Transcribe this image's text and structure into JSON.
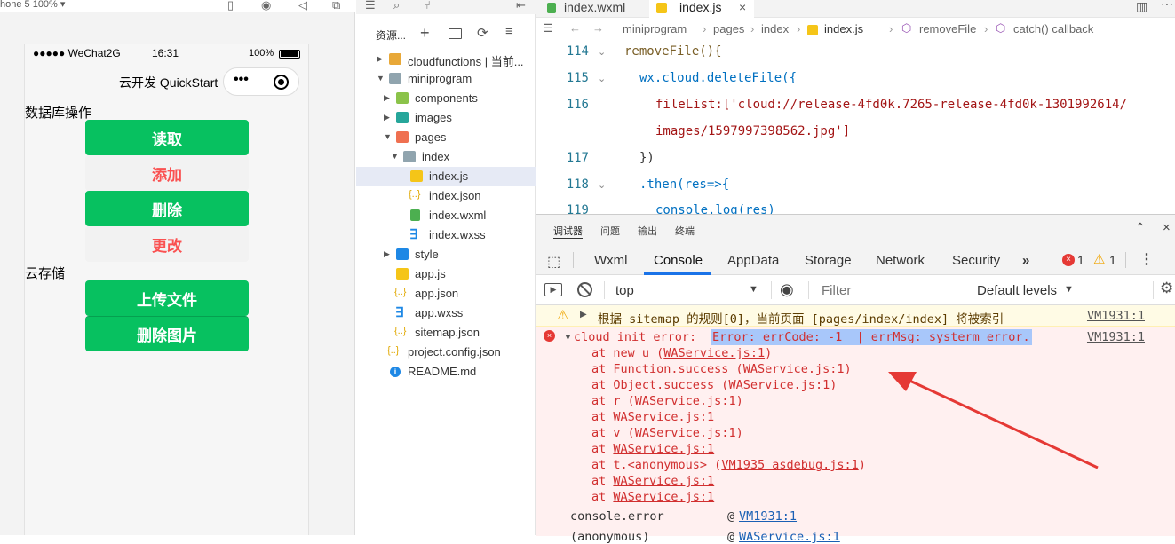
{
  "simulator": {
    "device_label": "hone 5 100% ▾",
    "status_carrier": "●●●●● WeChat2G",
    "status_time": "16:31",
    "status_battery": "100%",
    "nav_title": "云开发 QuickStart",
    "capsule_dots": "•••",
    "section_db": "数据库操作",
    "btn_read": "读取",
    "btn_add": "添加",
    "btn_delete": "删除",
    "btn_update": "更改",
    "section_storage": "云存储",
    "btn_upload": "上传文件",
    "btn_delete_image": "删除图片"
  },
  "explorer": {
    "title": "资源...",
    "items": [
      {
        "label": "cloudfunctions | 当前..."
      },
      {
        "label": "miniprogram"
      },
      {
        "label": "components"
      },
      {
        "label": "images"
      },
      {
        "label": "pages"
      },
      {
        "label": "index"
      },
      {
        "label": "index.js"
      },
      {
        "label": "index.json"
      },
      {
        "label": "index.wxml"
      },
      {
        "label": "index.wxss"
      },
      {
        "label": "style"
      },
      {
        "label": "app.js"
      },
      {
        "label": "app.json"
      },
      {
        "label": "app.wxss"
      },
      {
        "label": "sitemap.json"
      },
      {
        "label": "project.config.json"
      },
      {
        "label": "README.md"
      }
    ]
  },
  "editor": {
    "tabs": [
      "index.wxml",
      "index.js"
    ],
    "breadcrumb": [
      "miniprogram",
      "pages",
      "index",
      "index.js",
      "removeFile",
      "catch() callback"
    ],
    "lines": [
      {
        "num": "114",
        "code": "removeFile(){"
      },
      {
        "num": "115",
        "code": "wx.cloud.deleteFile({"
      },
      {
        "num": "116",
        "code": "fileList:['cloud://release-4fd0k.7265-release-4fd0k-1301992614/"
      },
      {
        "num": "",
        "code": "images/1597997398562.jpg']"
      },
      {
        "num": "117",
        "code": "})"
      },
      {
        "num": "118",
        "code": ".then(res=>{"
      },
      {
        "num": "119",
        "code": "console.log(res)"
      }
    ]
  },
  "devtools": {
    "top_tabs": [
      "调试器",
      "问题",
      "输出",
      "终端"
    ],
    "tabs": [
      "Wxml",
      "Console",
      "AppData",
      "Storage",
      "Network",
      "Security"
    ],
    "more": "»",
    "error_count": "1",
    "warning_count": "1",
    "context": "top",
    "filter_placeholder": "Filter",
    "levels": "Default levels",
    "warning_text": "根据 sitemap 的规则[0]，当前页面 [pages/index/index] 将被索引",
    "warning_src": "VM1931:1",
    "error_prefix": "cloud init error: ",
    "error_highlight": "Error: errCode: -1  | errMsg: systerm error.",
    "error_src": "VM1931:1",
    "stack": [
      {
        "pre": "at new u (",
        "link": "WAService.js:1",
        "post": ")"
      },
      {
        "pre": "at Function.success (",
        "link": "WAService.js:1",
        "post": ")"
      },
      {
        "pre": "at Object.success (",
        "link": "WAService.js:1",
        "post": ")"
      },
      {
        "pre": "at r (",
        "link": "WAService.js:1",
        "post": ")"
      },
      {
        "pre": "at ",
        "link": "WAService.js:1",
        "post": ""
      },
      {
        "pre": "at v (",
        "link": "WAService.js:1",
        "post": ")"
      },
      {
        "pre": "at ",
        "link": "WAService.js:1",
        "post": ""
      },
      {
        "pre": "at t.<anonymous> (",
        "link": "VM1935 asdebug.js:1",
        "post": ")"
      },
      {
        "pre": "at ",
        "link": "WAService.js:1",
        "post": ""
      },
      {
        "pre": "at ",
        "link": "WAService.js:1",
        "post": ""
      }
    ],
    "footer_fn": "console.error",
    "footer_at": "@",
    "footer_src": "VM1931:1",
    "footer2_fn": "(anonymous)",
    "footer2_at": "@",
    "footer2_src": "WAService.js:1"
  },
  "colors": {
    "green": "#07c160",
    "danger": "#fa5151",
    "error_bg": "#fff0f0",
    "arrow": "#e53935"
  }
}
